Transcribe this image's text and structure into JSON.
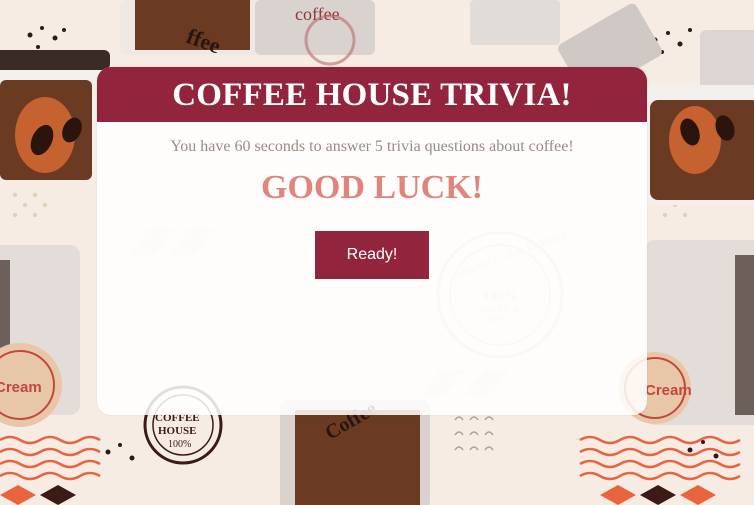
{
  "background": {
    "pattern": "coffee-cups-illustration",
    "texts": {
      "cream_left": "Cream",
      "cream_right": "Cream",
      "coffee_top": "coffee",
      "stamp_line1": "COFFEE",
      "stamp_line2": "HOUSE",
      "stamp_line3": "100%",
      "roasters_seal_top": "Quality Coffee Roasters",
      "roasters_seal_mid": "100%",
      "roasters_seal_sub": "ARABICA",
      "roasters_seal_bot": "100%"
    }
  },
  "card": {
    "title": "COFFEE HOUSE TRIVIA!",
    "instructions": "You have 60 seconds to answer 5 trivia questions about coffee!",
    "good_luck": "GOOD LUCK!",
    "ready_label": "Ready!"
  },
  "colors": {
    "accent": "#93243d",
    "good_luck": "#e0847c",
    "instructions_text": "#9b8a86"
  }
}
